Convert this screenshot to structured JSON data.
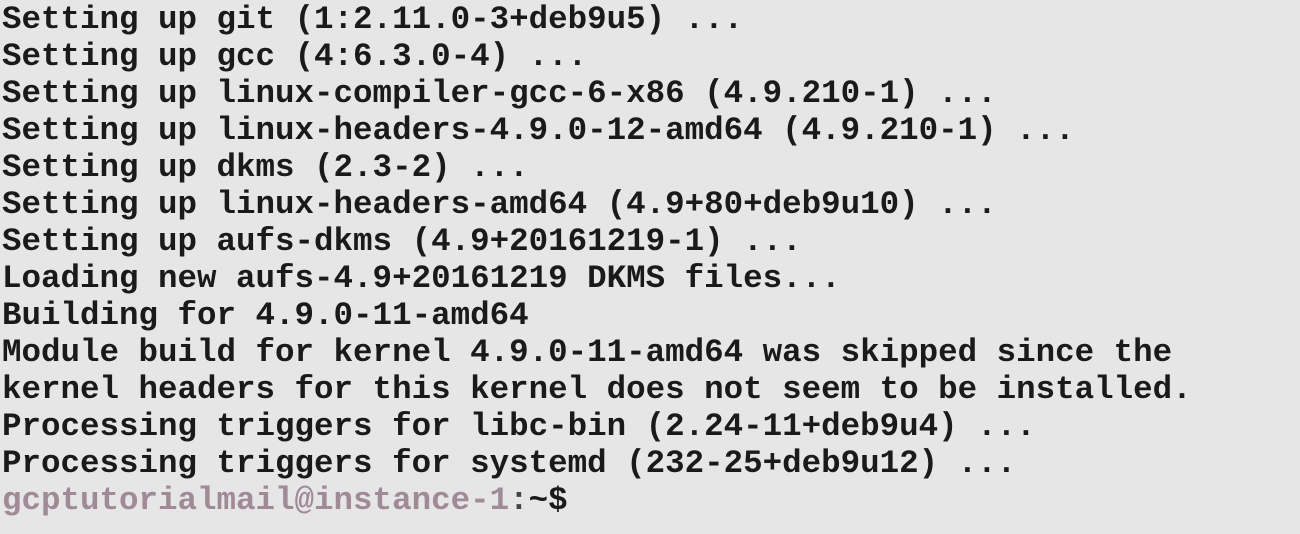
{
  "colors": {
    "background": "#e6e6e6",
    "text": "#1a1a1a",
    "prompt_user": "#a08a96"
  },
  "output_lines": [
    "Setting up git (1:2.11.0-3+deb9u5) ...",
    "Setting up gcc (4:6.3.0-4) ...",
    "Setting up linux-compiler-gcc-6-x86 (4.9.210-1) ...",
    "Setting up linux-headers-4.9.0-12-amd64 (4.9.210-1) ...",
    "Setting up dkms (2.3-2) ...",
    "Setting up linux-headers-amd64 (4.9+80+deb9u10) ...",
    "Setting up aufs-dkms (4.9+20161219-1) ...",
    "Loading new aufs-4.9+20161219 DKMS files...",
    "Building for 4.9.0-11-amd64",
    "Module build for kernel 4.9.0-11-amd64 was skipped since the",
    "kernel headers for this kernel does not seem to be installed.",
    "Processing triggers for libc-bin (2.24-11+deb9u4) ...",
    "Processing triggers for systemd (232-25+deb9u12) ..."
  ],
  "prompt": {
    "user_host": "gcptutorialmail@instance-1",
    "separator": ":",
    "path": "~$"
  }
}
